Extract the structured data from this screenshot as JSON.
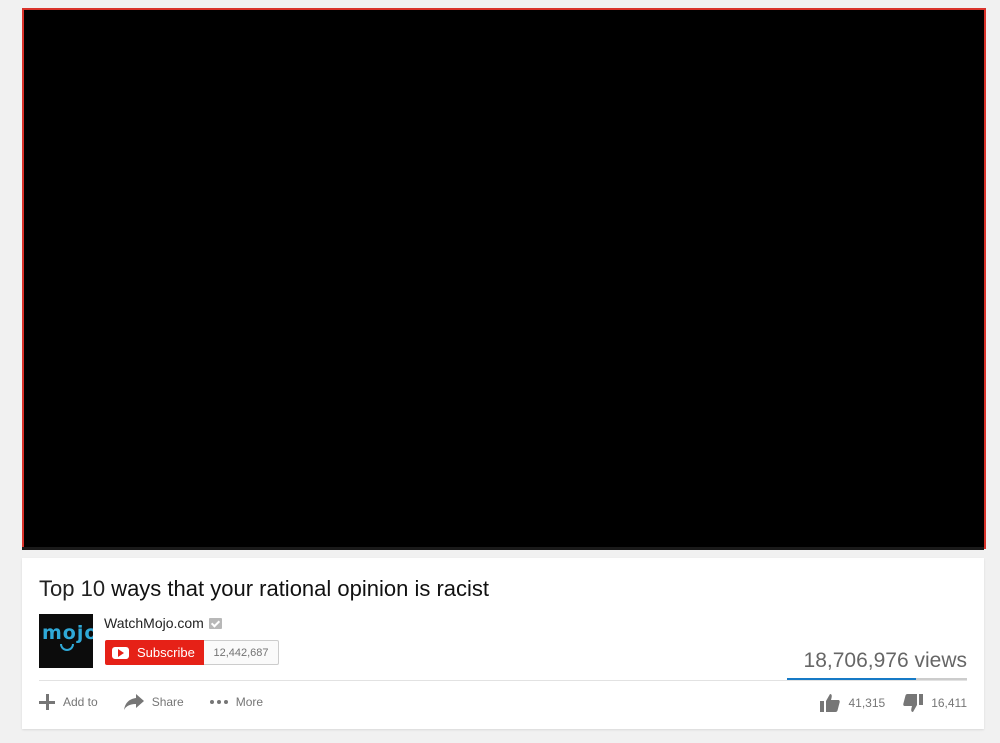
{
  "video": {
    "title_prefix": "Top 10",
    "title_rest": " ways that your rational opinion is racist"
  },
  "channel": {
    "name": "WatchMojo.com",
    "avatar_text": "mojo",
    "subscribe_label": "Subscribe",
    "subscriber_count": "12,442,687"
  },
  "stats": {
    "views": "18,706,976 views",
    "likes": "41,315",
    "dislikes": "16,411",
    "like_ratio": 0.716
  },
  "actions": {
    "add_to": "Add to",
    "share": "Share",
    "more": "More"
  },
  "colors": {
    "subscribe": "#e62117",
    "player_border": "#d9332b",
    "like_bar": "#167ac6"
  }
}
